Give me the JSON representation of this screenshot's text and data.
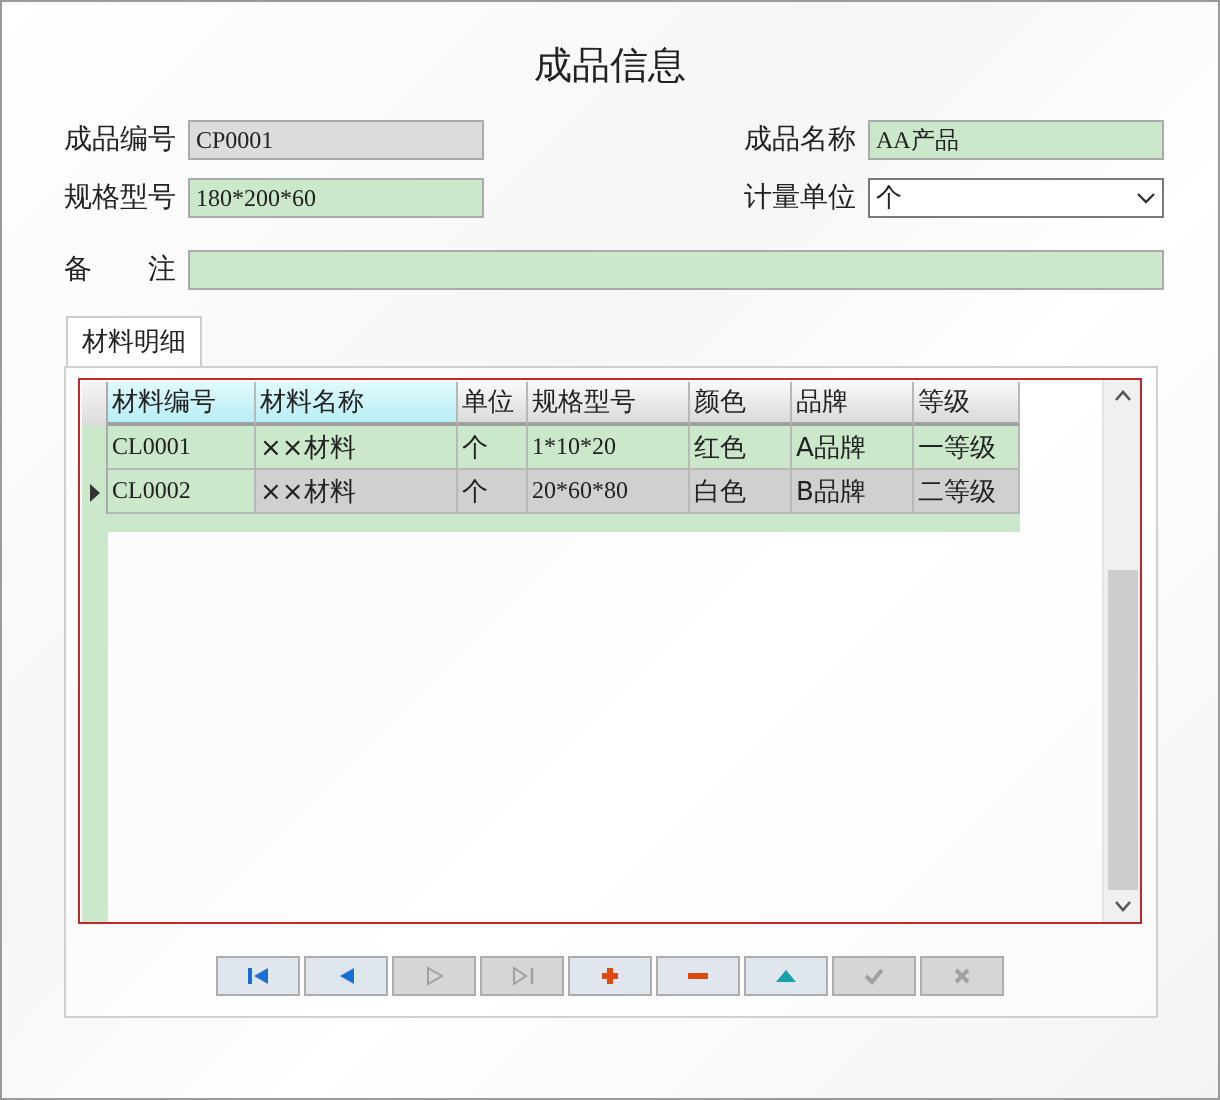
{
  "window": {
    "title": "成品信息"
  },
  "fields": [
    {
      "label": "成品编号",
      "value": "CP0001",
      "kind": "text",
      "disabled": true
    },
    {
      "label": "成品名称",
      "value": "AA产品",
      "kind": "text",
      "disabled": false
    },
    {
      "label": "规格型号",
      "value": "180*200*60",
      "kind": "text",
      "disabled": false
    },
    {
      "label": "计量单位",
      "value": "个",
      "kind": "combo",
      "disabled": false
    }
  ],
  "remark": {
    "label_parts": [
      "备",
      "注"
    ]
  },
  "tabs": [
    {
      "label": "材料明细",
      "selected": true
    }
  ],
  "table": {
    "columns": [
      {
        "label": "材料编号",
        "selected": true
      },
      {
        "label": "材料名称",
        "selected": true
      },
      {
        "label": "单位",
        "selected": false
      },
      {
        "label": "规格型号",
        "selected": false
      },
      {
        "label": "颜色",
        "selected": false
      },
      {
        "label": "品牌",
        "selected": false
      },
      {
        "label": "等级",
        "selected": false
      }
    ],
    "rows": [
      {
        "selected": false,
        "cells": [
          "CL0001",
          "××材料",
          "个",
          "1*10*20",
          "红色",
          "A品牌",
          "一等级"
        ]
      },
      {
        "selected": true,
        "cells": [
          "CL0002",
          "××材料",
          "个",
          "20*60*80",
          "白色",
          "B品牌",
          "二等级"
        ]
      }
    ]
  },
  "navigator": [
    {
      "kind": "first",
      "disabled": false
    },
    {
      "kind": "prior",
      "disabled": false
    },
    {
      "kind": "next",
      "disabled": true
    },
    {
      "kind": "last",
      "disabled": true
    },
    {
      "kind": "insert",
      "disabled": false
    },
    {
      "kind": "delete",
      "disabled": false
    },
    {
      "kind": "edit",
      "disabled": false
    },
    {
      "kind": "post",
      "disabled": true
    },
    {
      "kind": "cancel",
      "disabled": true
    }
  ]
}
